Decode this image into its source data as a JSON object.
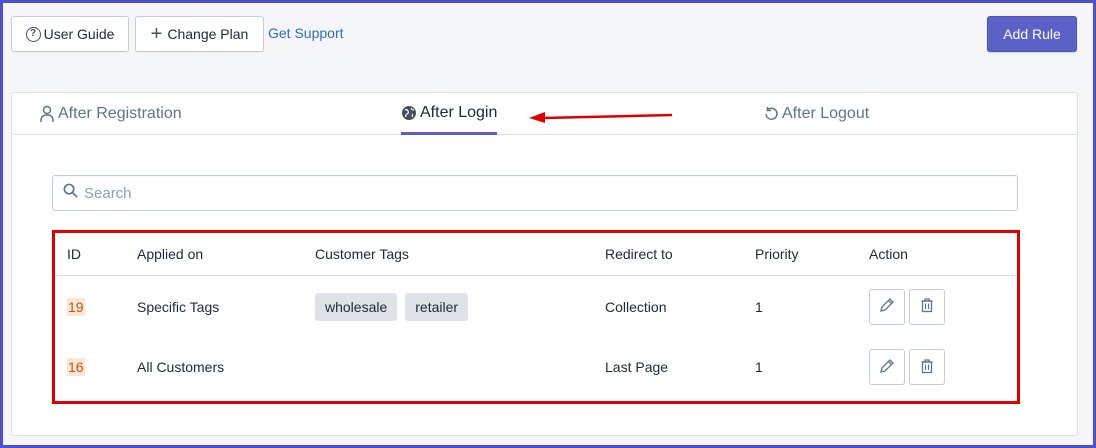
{
  "toolbar": {
    "user_guide_label": "User Guide",
    "change_plan_label": "Change Plan",
    "support_label": "Get Support",
    "add_rule_label": "Add Rule"
  },
  "tabs": [
    {
      "label": "After Registration",
      "icon": "user-icon",
      "active": false
    },
    {
      "label": "After Login",
      "icon": "globe-icon",
      "active": true
    },
    {
      "label": "After Logout",
      "icon": "undo-icon",
      "active": false
    }
  ],
  "search": {
    "placeholder": "Search",
    "value": ""
  },
  "table": {
    "headers": [
      "ID",
      "Applied on",
      "Customer Tags",
      "Redirect to",
      "Priority",
      "Action"
    ],
    "rows": [
      {
        "id": "19",
        "applied_on": "Specific Tags",
        "tags": [
          "wholesale",
          "retailer"
        ],
        "redirect_to": "Collection",
        "priority": "1"
      },
      {
        "id": "16",
        "applied_on": "All Customers",
        "tags": [],
        "redirect_to": "Last Page",
        "priority": "1"
      }
    ]
  },
  "colors": {
    "accent": "#5c61c7",
    "annotation_red": "#e00000",
    "frame_border": "#4a4fd6",
    "id_badge_bg": "#fde7d4",
    "id_badge_text": "#c05717"
  }
}
